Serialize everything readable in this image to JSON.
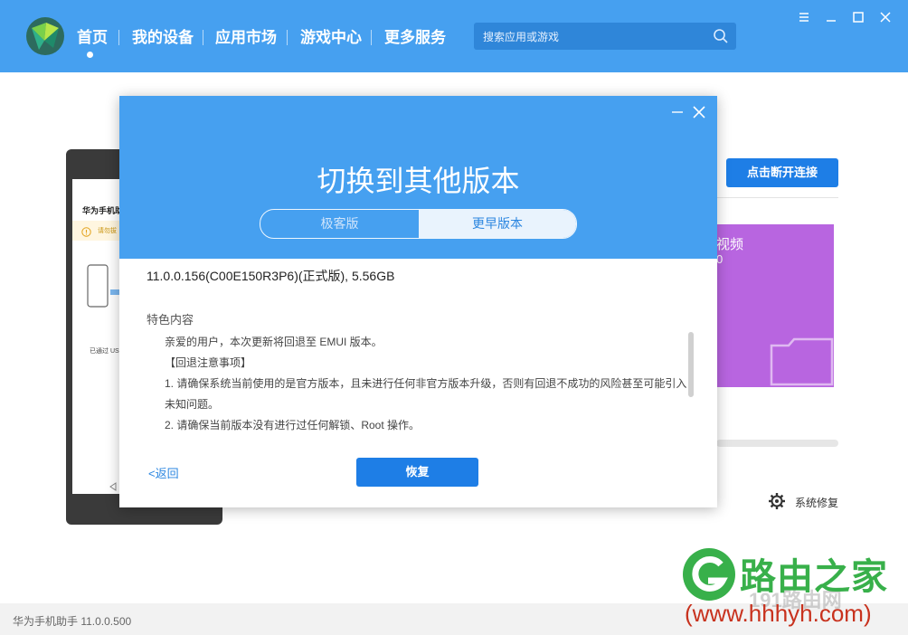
{
  "topbar": {
    "nav": [
      {
        "label": "首页",
        "active": true
      },
      {
        "label": "我的设备"
      },
      {
        "label": "应用市场"
      },
      {
        "label": "游戏中心"
      },
      {
        "label": "更多服务"
      }
    ],
    "search_placeholder": "搜索应用或游戏"
  },
  "background": {
    "phone_title": "华为手机助",
    "phone_warning": "请勿拔",
    "phone_connected": "已通过 US",
    "disconnect_label": "点击断开连接",
    "card_title": "视频",
    "card_value": "0",
    "system_repair": "系统修复",
    "status_text": "华为手机助手 11.0.0.500"
  },
  "dialog": {
    "title": "切换到其他版本",
    "tabs": [
      "极客版",
      "更早版本"
    ],
    "active_tab": "更早版本",
    "version_line": "11.0.0.156(C00E150R3P6)(正式版), 5.56GB",
    "features_label": "特色内容",
    "notes": [
      "亲爱的用户，本次更新将回退至 EMUI  版本。",
      "【回退注意事项】",
      "1. 请确保系统当前使用的是官方版本，且未进行任何非官方版本升级，否则有回退不成功的风险甚至可能引入",
      "未知问题。",
      "2. 请确保当前版本没有进行过任何解锁、Root 操作。"
    ],
    "back_label": "<返回",
    "restore_label": "恢复"
  },
  "watermark": {
    "brand": "路由之家",
    "url": "(www.hhhyh.com)",
    "num": "191路由网"
  },
  "colors": {
    "primary": "#46a0f0",
    "button": "#1e7ee6",
    "purple_card": "#b865e0",
    "watermark_green": "#38b04a",
    "watermark_red": "#c8321e"
  }
}
